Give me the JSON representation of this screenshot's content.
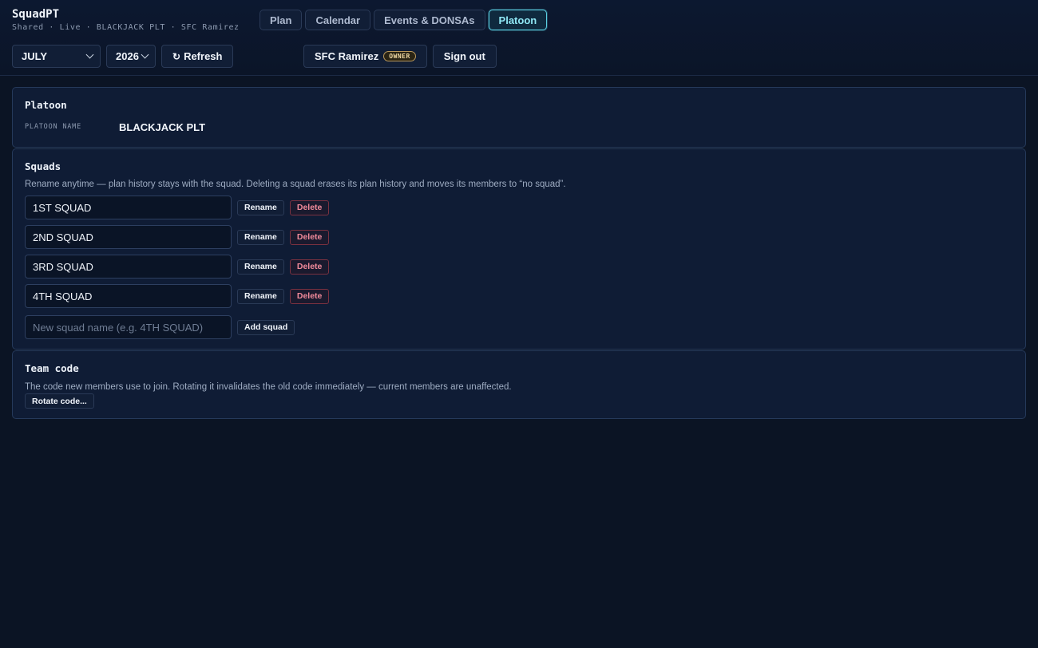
{
  "app": {
    "title": "SquadPT",
    "subtitle": "Shared · Live · BLACKJACK PLT · SFC Ramirez"
  },
  "nav": {
    "tabs": [
      {
        "label": "Plan",
        "active": false
      },
      {
        "label": "Calendar",
        "active": false
      },
      {
        "label": "Events & DONSAs",
        "active": false
      },
      {
        "label": "Platoon",
        "active": true
      }
    ]
  },
  "controls": {
    "month": "JULY",
    "year": "2026",
    "refresh_label": "Refresh",
    "refresh_icon": "refresh-icon"
  },
  "user": {
    "name": "SFC Ramirez",
    "role_badge": "OWNER",
    "signout_label": "Sign out"
  },
  "platoon": {
    "title": "Platoon",
    "name_label": "PLATOON NAME",
    "name_value": "BLACKJACK PLT"
  },
  "squads": {
    "title": "Squads",
    "description": "Rename anytime — plan history stays with the squad. Deleting a squad erases its plan history and moves its members to “no squad”.",
    "items": [
      {
        "name": "1ST SQUAD"
      },
      {
        "name": "2ND SQUAD"
      },
      {
        "name": "3RD SQUAD"
      },
      {
        "name": "4TH SQUAD"
      }
    ],
    "rename_label": "Rename",
    "delete_label": "Delete",
    "new_placeholder": "New squad name (e.g. 4TH SQUAD)",
    "add_label": "Add squad"
  },
  "team_code": {
    "title": "Team code",
    "description": "The code new members use to join. Rotating it invalidates the old code immediately — current members are unaffected.",
    "rotate_label": "Rotate code..."
  },
  "colors": {
    "background": "#0b1424",
    "card": "#0f1c35",
    "accent": "#5bd0e3",
    "danger": "#f08a9a",
    "owner_badge": "#f0d9a4"
  }
}
